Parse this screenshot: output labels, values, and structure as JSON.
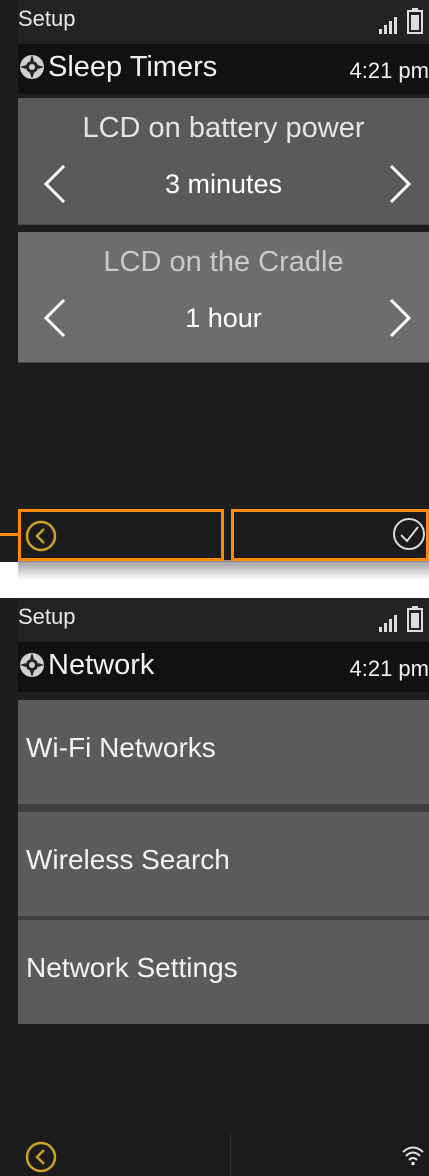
{
  "colors": {
    "highlight": "#ff8a00",
    "back_button": "#c9a227",
    "panel": "#5a5a5a"
  },
  "screen1": {
    "status": {
      "section": "Setup",
      "icons": [
        "signal-icon",
        "battery-icon"
      ]
    },
    "header": {
      "title": "Sleep Timers",
      "time": "4:21 pm",
      "icon": "gear-icon"
    },
    "selectors": [
      {
        "label": "LCD on battery power",
        "value": "3 minutes"
      },
      {
        "label": "LCD on the Cradle",
        "value": "1 hour"
      }
    ],
    "footer": {
      "back_icon": "back-circle-icon",
      "confirm_icon": "check-circle-icon"
    }
  },
  "screen2": {
    "status": {
      "section": "Setup",
      "icons": [
        "signal-icon",
        "battery-icon"
      ]
    },
    "header": {
      "title": "Network",
      "time": "4:21 pm",
      "icon": "gear-icon"
    },
    "menu": [
      {
        "label": "Wi-Fi Networks"
      },
      {
        "label": "Wireless Search"
      },
      {
        "label": "Network Settings"
      }
    ],
    "footer": {
      "back_icon": "back-circle-icon",
      "status_icon": "wifi-icon"
    }
  }
}
